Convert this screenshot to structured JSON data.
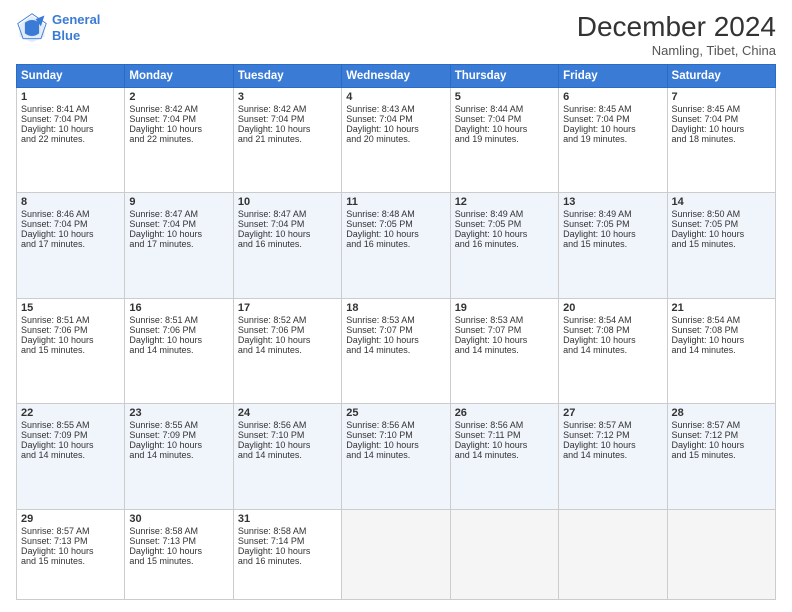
{
  "header": {
    "logo_line1": "General",
    "logo_line2": "Blue",
    "main_title": "December 2024",
    "subtitle": "Namling, Tibet, China"
  },
  "days_of_week": [
    "Sunday",
    "Monday",
    "Tuesday",
    "Wednesday",
    "Thursday",
    "Friday",
    "Saturday"
  ],
  "weeks": [
    [
      {
        "day": "1",
        "lines": [
          "Sunrise: 8:41 AM",
          "Sunset: 7:04 PM",
          "Daylight: 10 hours",
          "and 22 minutes."
        ]
      },
      {
        "day": "2",
        "lines": [
          "Sunrise: 8:42 AM",
          "Sunset: 7:04 PM",
          "Daylight: 10 hours",
          "and 22 minutes."
        ]
      },
      {
        "day": "3",
        "lines": [
          "Sunrise: 8:42 AM",
          "Sunset: 7:04 PM",
          "Daylight: 10 hours",
          "and 21 minutes."
        ]
      },
      {
        "day": "4",
        "lines": [
          "Sunrise: 8:43 AM",
          "Sunset: 7:04 PM",
          "Daylight: 10 hours",
          "and 20 minutes."
        ]
      },
      {
        "day": "5",
        "lines": [
          "Sunrise: 8:44 AM",
          "Sunset: 7:04 PM",
          "Daylight: 10 hours",
          "and 19 minutes."
        ]
      },
      {
        "day": "6",
        "lines": [
          "Sunrise: 8:45 AM",
          "Sunset: 7:04 PM",
          "Daylight: 10 hours",
          "and 19 minutes."
        ]
      },
      {
        "day": "7",
        "lines": [
          "Sunrise: 8:45 AM",
          "Sunset: 7:04 PM",
          "Daylight: 10 hours",
          "and 18 minutes."
        ]
      }
    ],
    [
      {
        "day": "8",
        "lines": [
          "Sunrise: 8:46 AM",
          "Sunset: 7:04 PM",
          "Daylight: 10 hours",
          "and 17 minutes."
        ]
      },
      {
        "day": "9",
        "lines": [
          "Sunrise: 8:47 AM",
          "Sunset: 7:04 PM",
          "Daylight: 10 hours",
          "and 17 minutes."
        ]
      },
      {
        "day": "10",
        "lines": [
          "Sunrise: 8:47 AM",
          "Sunset: 7:04 PM",
          "Daylight: 10 hours",
          "and 16 minutes."
        ]
      },
      {
        "day": "11",
        "lines": [
          "Sunrise: 8:48 AM",
          "Sunset: 7:05 PM",
          "Daylight: 10 hours",
          "and 16 minutes."
        ]
      },
      {
        "day": "12",
        "lines": [
          "Sunrise: 8:49 AM",
          "Sunset: 7:05 PM",
          "Daylight: 10 hours",
          "and 16 minutes."
        ]
      },
      {
        "day": "13",
        "lines": [
          "Sunrise: 8:49 AM",
          "Sunset: 7:05 PM",
          "Daylight: 10 hours",
          "and 15 minutes."
        ]
      },
      {
        "day": "14",
        "lines": [
          "Sunrise: 8:50 AM",
          "Sunset: 7:05 PM",
          "Daylight: 10 hours",
          "and 15 minutes."
        ]
      }
    ],
    [
      {
        "day": "15",
        "lines": [
          "Sunrise: 8:51 AM",
          "Sunset: 7:06 PM",
          "Daylight: 10 hours",
          "and 15 minutes."
        ]
      },
      {
        "day": "16",
        "lines": [
          "Sunrise: 8:51 AM",
          "Sunset: 7:06 PM",
          "Daylight: 10 hours",
          "and 14 minutes."
        ]
      },
      {
        "day": "17",
        "lines": [
          "Sunrise: 8:52 AM",
          "Sunset: 7:06 PM",
          "Daylight: 10 hours",
          "and 14 minutes."
        ]
      },
      {
        "day": "18",
        "lines": [
          "Sunrise: 8:53 AM",
          "Sunset: 7:07 PM",
          "Daylight: 10 hours",
          "and 14 minutes."
        ]
      },
      {
        "day": "19",
        "lines": [
          "Sunrise: 8:53 AM",
          "Sunset: 7:07 PM",
          "Daylight: 10 hours",
          "and 14 minutes."
        ]
      },
      {
        "day": "20",
        "lines": [
          "Sunrise: 8:54 AM",
          "Sunset: 7:08 PM",
          "Daylight: 10 hours",
          "and 14 minutes."
        ]
      },
      {
        "day": "21",
        "lines": [
          "Sunrise: 8:54 AM",
          "Sunset: 7:08 PM",
          "Daylight: 10 hours",
          "and 14 minutes."
        ]
      }
    ],
    [
      {
        "day": "22",
        "lines": [
          "Sunrise: 8:55 AM",
          "Sunset: 7:09 PM",
          "Daylight: 10 hours",
          "and 14 minutes."
        ]
      },
      {
        "day": "23",
        "lines": [
          "Sunrise: 8:55 AM",
          "Sunset: 7:09 PM",
          "Daylight: 10 hours",
          "and 14 minutes."
        ]
      },
      {
        "day": "24",
        "lines": [
          "Sunrise: 8:56 AM",
          "Sunset: 7:10 PM",
          "Daylight: 10 hours",
          "and 14 minutes."
        ]
      },
      {
        "day": "25",
        "lines": [
          "Sunrise: 8:56 AM",
          "Sunset: 7:10 PM",
          "Daylight: 10 hours",
          "and 14 minutes."
        ]
      },
      {
        "day": "26",
        "lines": [
          "Sunrise: 8:56 AM",
          "Sunset: 7:11 PM",
          "Daylight: 10 hours",
          "and 14 minutes."
        ]
      },
      {
        "day": "27",
        "lines": [
          "Sunrise: 8:57 AM",
          "Sunset: 7:12 PM",
          "Daylight: 10 hours",
          "and 14 minutes."
        ]
      },
      {
        "day": "28",
        "lines": [
          "Sunrise: 8:57 AM",
          "Sunset: 7:12 PM",
          "Daylight: 10 hours",
          "and 15 minutes."
        ]
      }
    ],
    [
      {
        "day": "29",
        "lines": [
          "Sunrise: 8:57 AM",
          "Sunset: 7:13 PM",
          "Daylight: 10 hours",
          "and 15 minutes."
        ]
      },
      {
        "day": "30",
        "lines": [
          "Sunrise: 8:58 AM",
          "Sunset: 7:13 PM",
          "Daylight: 10 hours",
          "and 15 minutes."
        ]
      },
      {
        "day": "31",
        "lines": [
          "Sunrise: 8:58 AM",
          "Sunset: 7:14 PM",
          "Daylight: 10 hours",
          "and 16 minutes."
        ]
      },
      null,
      null,
      null,
      null
    ]
  ]
}
